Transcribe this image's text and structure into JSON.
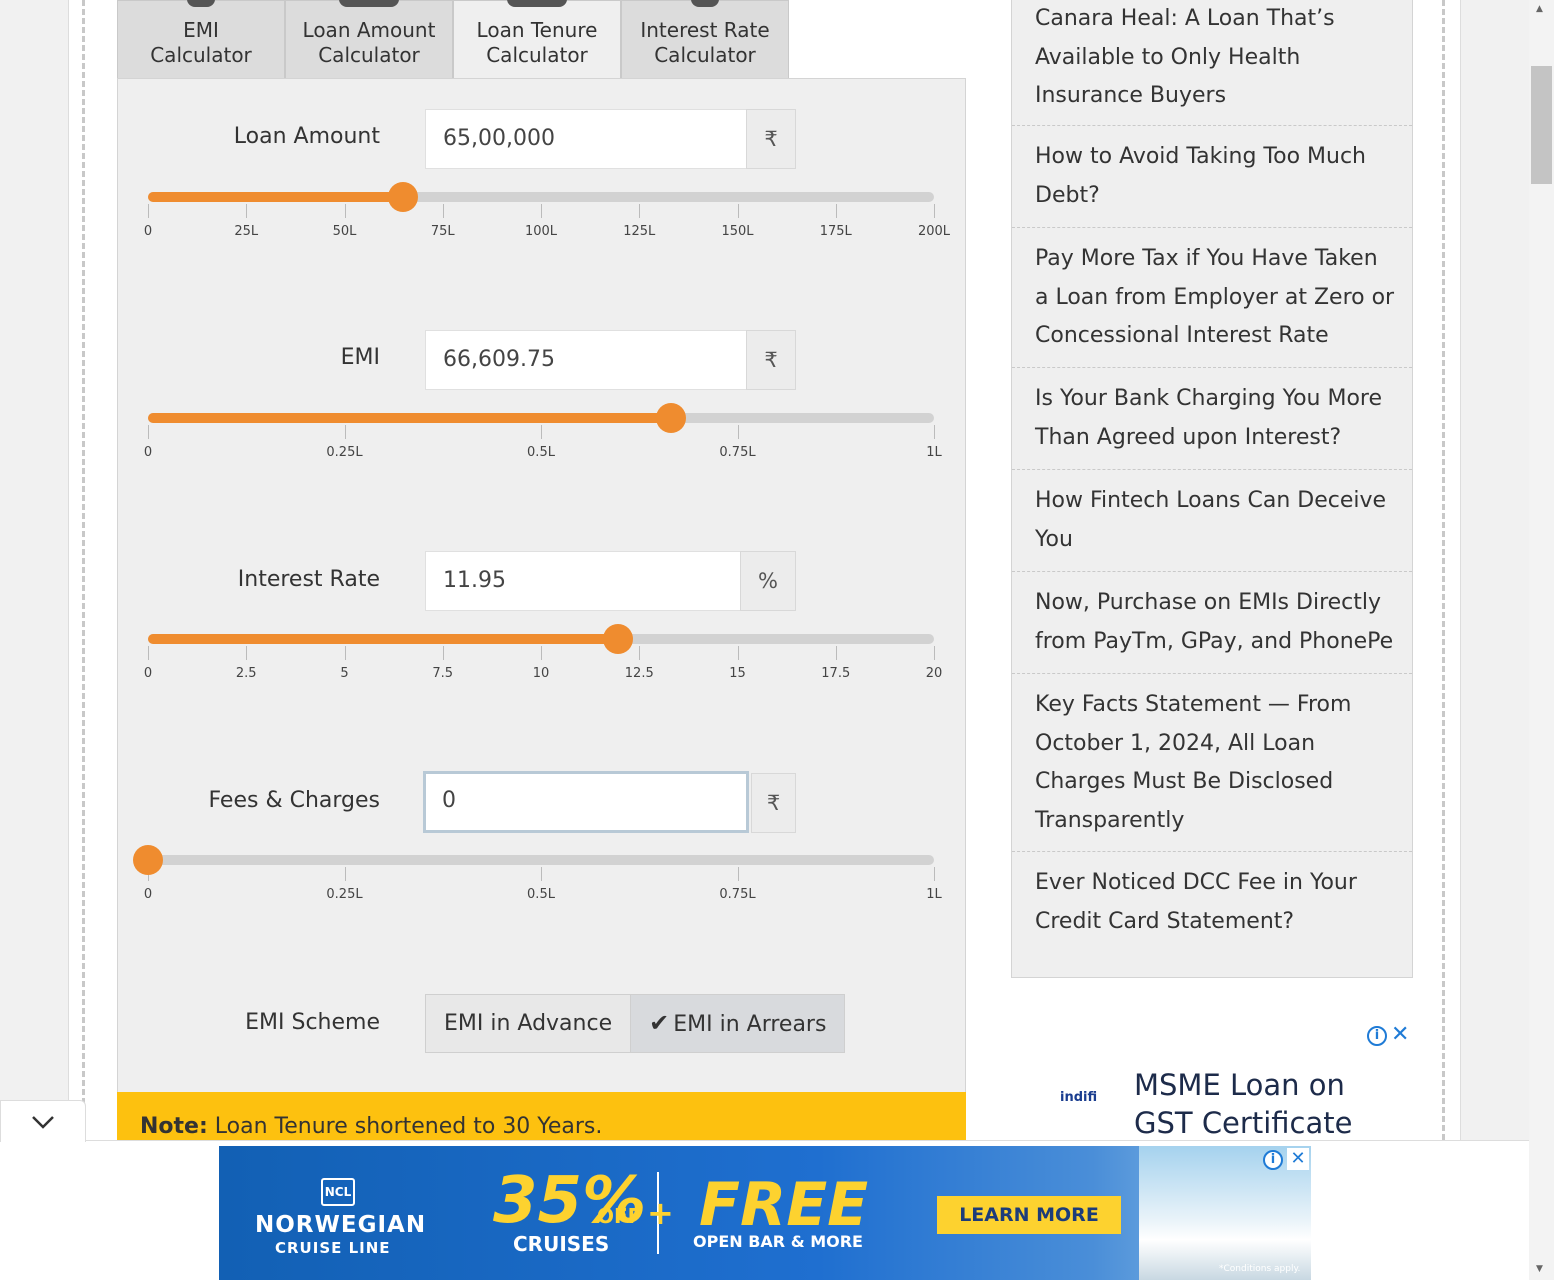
{
  "tabs": [
    {
      "line1": "EMI",
      "line2": "Calculator"
    },
    {
      "line1": "Loan Amount",
      "line2": "Calculator"
    },
    {
      "line1": "Loan Tenure",
      "line2": "Calculator"
    },
    {
      "line1": "Interest Rate",
      "line2": "Calculator"
    }
  ],
  "loan_amount": {
    "label": "Loan Amount",
    "value": "65,00,000",
    "unit": "₹",
    "slider_level": 0.325,
    "ticks": [
      "0",
      "25L",
      "50L",
      "75L",
      "100L",
      "125L",
      "150L",
      "175L",
      "200L"
    ]
  },
  "emi": {
    "label": "EMI",
    "value": "66,609.75",
    "unit": "₹",
    "slider_level": 0.666,
    "ticks": [
      "0",
      "0.25L",
      "0.5L",
      "0.75L",
      "1L"
    ]
  },
  "interest_rate": {
    "label": "Interest Rate",
    "value": "11.95",
    "unit": "%",
    "slider_level": 0.5975,
    "ticks": [
      "0",
      "2.5",
      "5",
      "7.5",
      "10",
      "12.5",
      "15",
      "17.5",
      "20"
    ]
  },
  "fees": {
    "label": "Fees & Charges",
    "value": "0",
    "unit": "₹",
    "slider_level": 0,
    "ticks": [
      "0",
      "0.25L",
      "0.5L",
      "0.75L",
      "1L"
    ]
  },
  "scheme": {
    "label": "EMI Scheme",
    "option_advance": "EMI in Advance",
    "option_arrears": "EMI in Arrears"
  },
  "note": {
    "prefix": "Note:",
    "text": "Loan Tenure shortened to 30 Years."
  },
  "sidebar": {
    "items": [
      "Canara Heal: A Loan That’s Available to Only Health Insurance Buyers",
      "How to Avoid Taking Too Much Debt?",
      "Pay More Tax if You Have Taken a Loan from Employer at Zero or Concessional Interest Rate",
      "Is Your Bank Charging You More Than Agreed upon Interest?",
      "How Fintech Loans Can Deceive You",
      "Now, Purchase on EMIs Directly from PayTm, GPay, and PhonePe",
      "Key Facts Statement — From October 1, 2024, All Loan Charges Must Be Disclosed Transparently",
      "Ever Noticed DCC Fee in Your Credit Card Statement?"
    ]
  },
  "side_ad": {
    "brand": "indifi",
    "headline_1": "MSME Loan on",
    "headline_2": "GST Certificate"
  },
  "bottom_ad": {
    "logo_badge": "NCL",
    "brand_1": "NORWEGIAN",
    "brand_2": "CRUISE LINE",
    "discount": "35%",
    "off": "OFF",
    "cruises": "CRUISES",
    "plus": "+",
    "free": "FREE",
    "free_sub": "OPEN BAR & MORE",
    "cta": "LEARN MORE",
    "disclaimer": "*Conditions apply."
  },
  "colors": {
    "accent": "#ef8c2f",
    "note_bg": "#fdc10f",
    "ad_blue": "#1f7bd6"
  }
}
